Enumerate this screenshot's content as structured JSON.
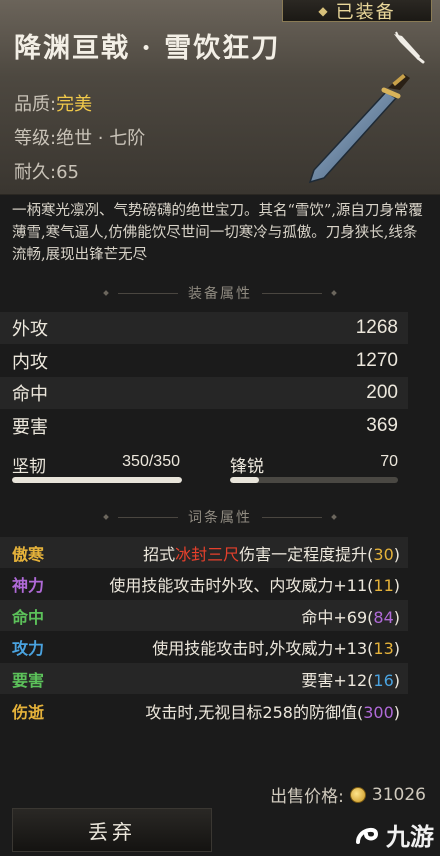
{
  "item": {
    "equipped_label": "已装备",
    "name": "降渊亘戟 · 雪饮狂刀",
    "quality_label": "品质:",
    "quality_value": "完美",
    "grade_label": "等级:",
    "grade_value": "绝世 · 七阶",
    "durability_label": "耐久:",
    "durability_value": "65",
    "description": "一柄寒光凛冽、气势磅礴的绝世宝刀。其名“雪饮”,源自刀身常覆薄雪,寒气逼人,仿佛能饮尽世间一切寒冷与孤傲。刀身狭长,线条流畅,展现出锋芒无尽"
  },
  "equip_attrs": {
    "title": "装备属性",
    "rows": [
      {
        "label": "外攻",
        "value": "1268"
      },
      {
        "label": "内攻",
        "value": "1270"
      },
      {
        "label": "命中",
        "value": "200"
      },
      {
        "label": "要害",
        "value": "369"
      }
    ],
    "toughness": {
      "label": "坚韧",
      "value": "350/350",
      "fill": 1.0
    },
    "sharpness": {
      "label": "锋锐",
      "value": "70",
      "fill": 0.17
    }
  },
  "affix_attrs": {
    "title": "词条属性",
    "rows": [
      {
        "label": "傲寒",
        "color": "#e5b23a",
        "pre": "招式",
        "highlight": "冰封三尺",
        "post": "伤害一定程度提升(",
        "pv": "30",
        "pv_color": "#e5b23a",
        "end": ")"
      },
      {
        "label": "神力",
        "color": "#b06ad8",
        "pre": "使用技能攻击时外攻、内攻威力+11(",
        "highlight": "",
        "post": "",
        "pv": "11",
        "pv_color": "#e5b23a",
        "end": ")"
      },
      {
        "label": "命中",
        "color": "#5cc25a",
        "pre": "命中+69(",
        "highlight": "",
        "post": "",
        "pv": "84",
        "pv_color": "#b06ad8",
        "end": ")"
      },
      {
        "label": "攻力",
        "color": "#4aa3e0",
        "pre": "使用技能攻击时,外攻威力+13(",
        "highlight": "",
        "post": "",
        "pv": "13",
        "pv_color": "#e5b23a",
        "end": ")"
      },
      {
        "label": "要害",
        "color": "#5cc25a",
        "pre": "要害+12(",
        "highlight": "",
        "post": "",
        "pv": "16",
        "pv_color": "#4aa3e0",
        "end": ")"
      },
      {
        "label": "伤逝",
        "color": "#e5b23a",
        "pre": "攻击时,无视目标258的防御值(",
        "highlight": "",
        "post": "",
        "pv": "300",
        "pv_color": "#b06ad8",
        "end": ")"
      }
    ]
  },
  "footer": {
    "price_label": "出售价格:",
    "price_value": "31026",
    "discard_label": "丢弃",
    "watermark": "九游"
  },
  "icons": [
    "diamond-icon",
    "blade-icon",
    "sword-icon",
    "coin-icon",
    "jiuyou-logo-icon"
  ]
}
